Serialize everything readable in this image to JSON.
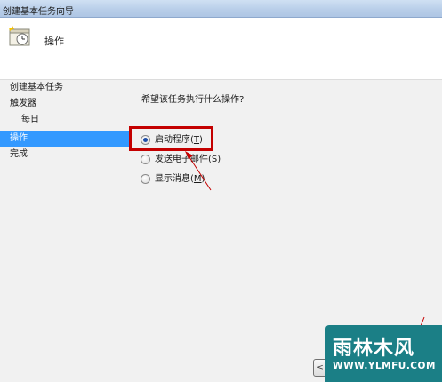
{
  "window": {
    "title": "创建基本任务向导"
  },
  "header": {
    "icon": "scheduled-task-clock-icon",
    "title": "操作"
  },
  "sidebar": {
    "items": [
      {
        "label": "创建基本任务",
        "selected": false
      },
      {
        "label": "触发器",
        "selected": false
      },
      {
        "label": "每日",
        "selected": false
      },
      {
        "label": "操作",
        "selected": true
      },
      {
        "label": "完成",
        "selected": false
      }
    ]
  },
  "content": {
    "question": "希望该任务执行什么操作?",
    "options": [
      {
        "label": "启动程序",
        "key": "T",
        "checked": true
      },
      {
        "label": "发送电子邮件",
        "key": "S",
        "checked": false
      },
      {
        "label": "显示消息",
        "key": "M",
        "checked": false
      }
    ]
  },
  "footer": {
    "back_button_label": "<"
  },
  "watermark": {
    "main_text": "雨林木风",
    "sub_text": "WWW.YLMFU.COM"
  },
  "colors": {
    "selection": "#3399ff",
    "annotation": "#c40000",
    "watermark_bg": "#1b7f86"
  }
}
